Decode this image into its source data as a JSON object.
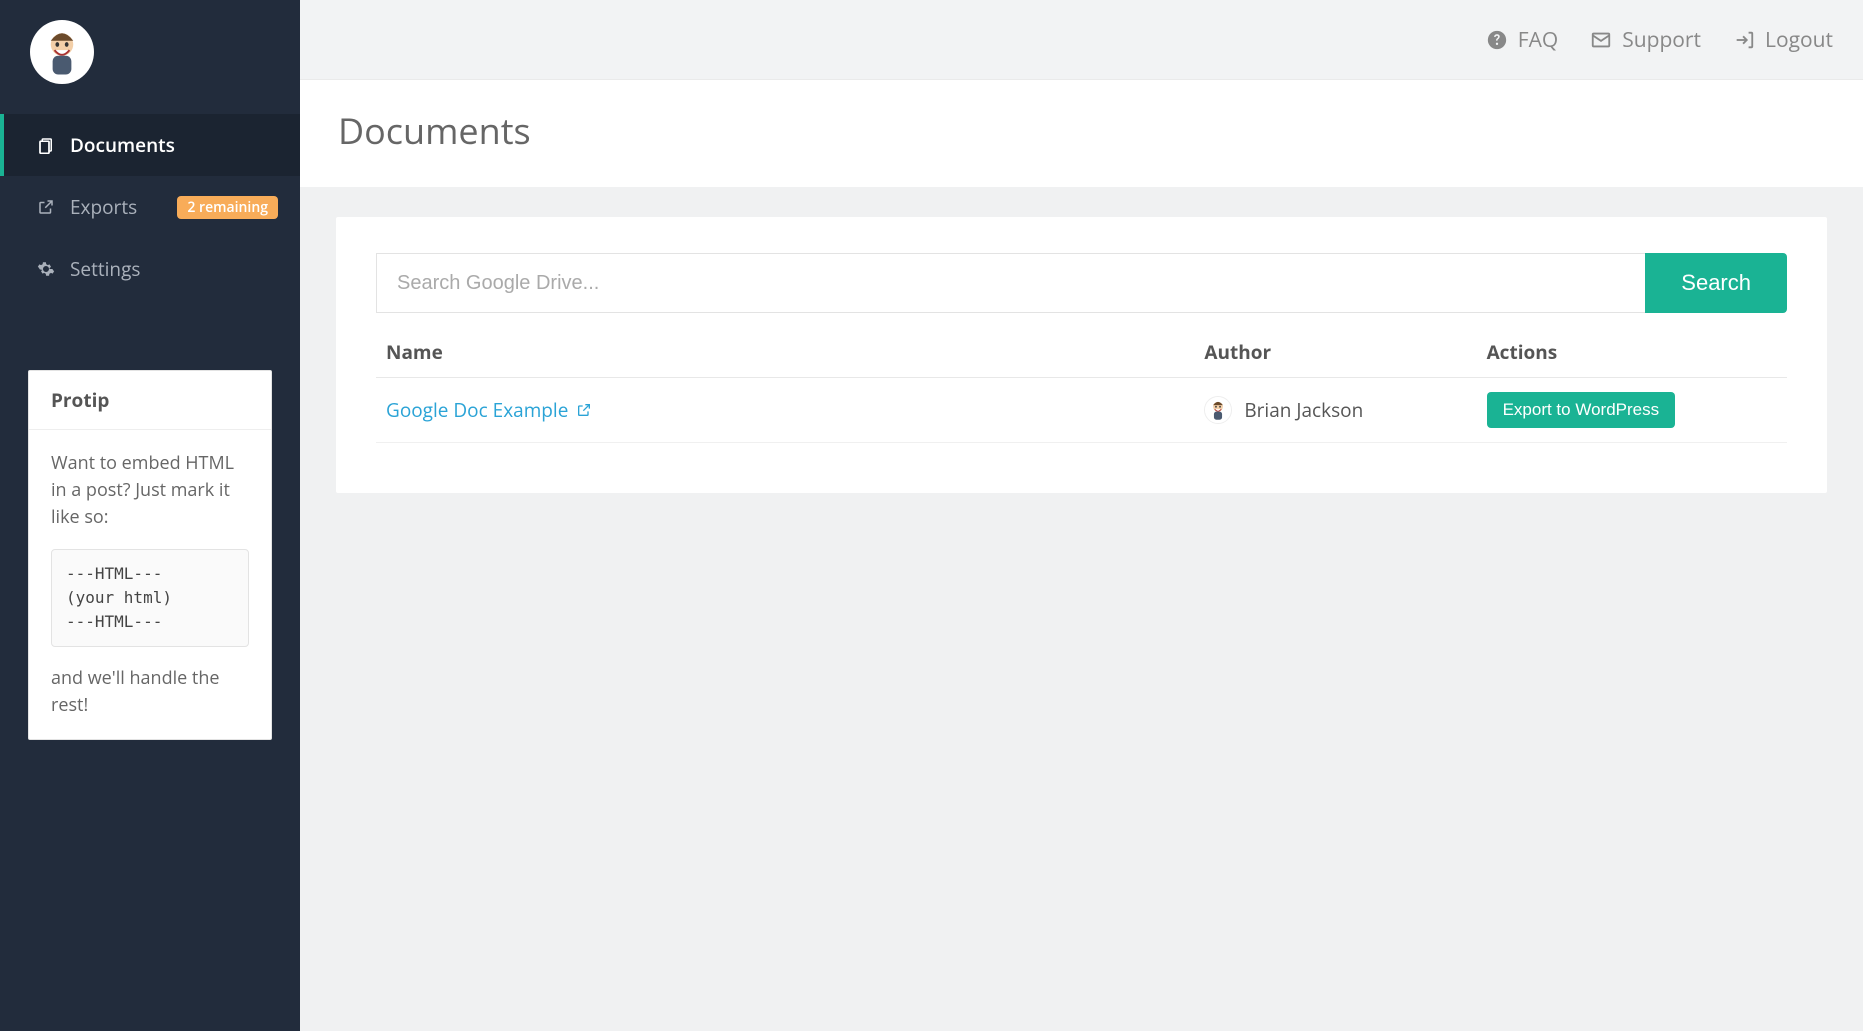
{
  "topbar": {
    "faq": "FAQ",
    "support": "Support",
    "logout": "Logout"
  },
  "sidebar": {
    "items": [
      {
        "label": "Documents"
      },
      {
        "label": "Exports",
        "badge": "2 remaining"
      },
      {
        "label": "Settings"
      }
    ]
  },
  "protip": {
    "title": "Protip",
    "lead": "Want to embed HTML in a post? Just mark it like so:",
    "code": "---HTML---\n(your html)\n---HTML---",
    "trail": "and we'll handle the rest!"
  },
  "page": {
    "title": "Documents"
  },
  "search": {
    "placeholder": "Search Google Drive...",
    "button": "Search"
  },
  "table": {
    "headers": {
      "name": "Name",
      "author": "Author",
      "actions": "Actions"
    },
    "rows": [
      {
        "name": "Google Doc Example",
        "author": "Brian Jackson",
        "action": "Export to WordPress"
      }
    ]
  }
}
